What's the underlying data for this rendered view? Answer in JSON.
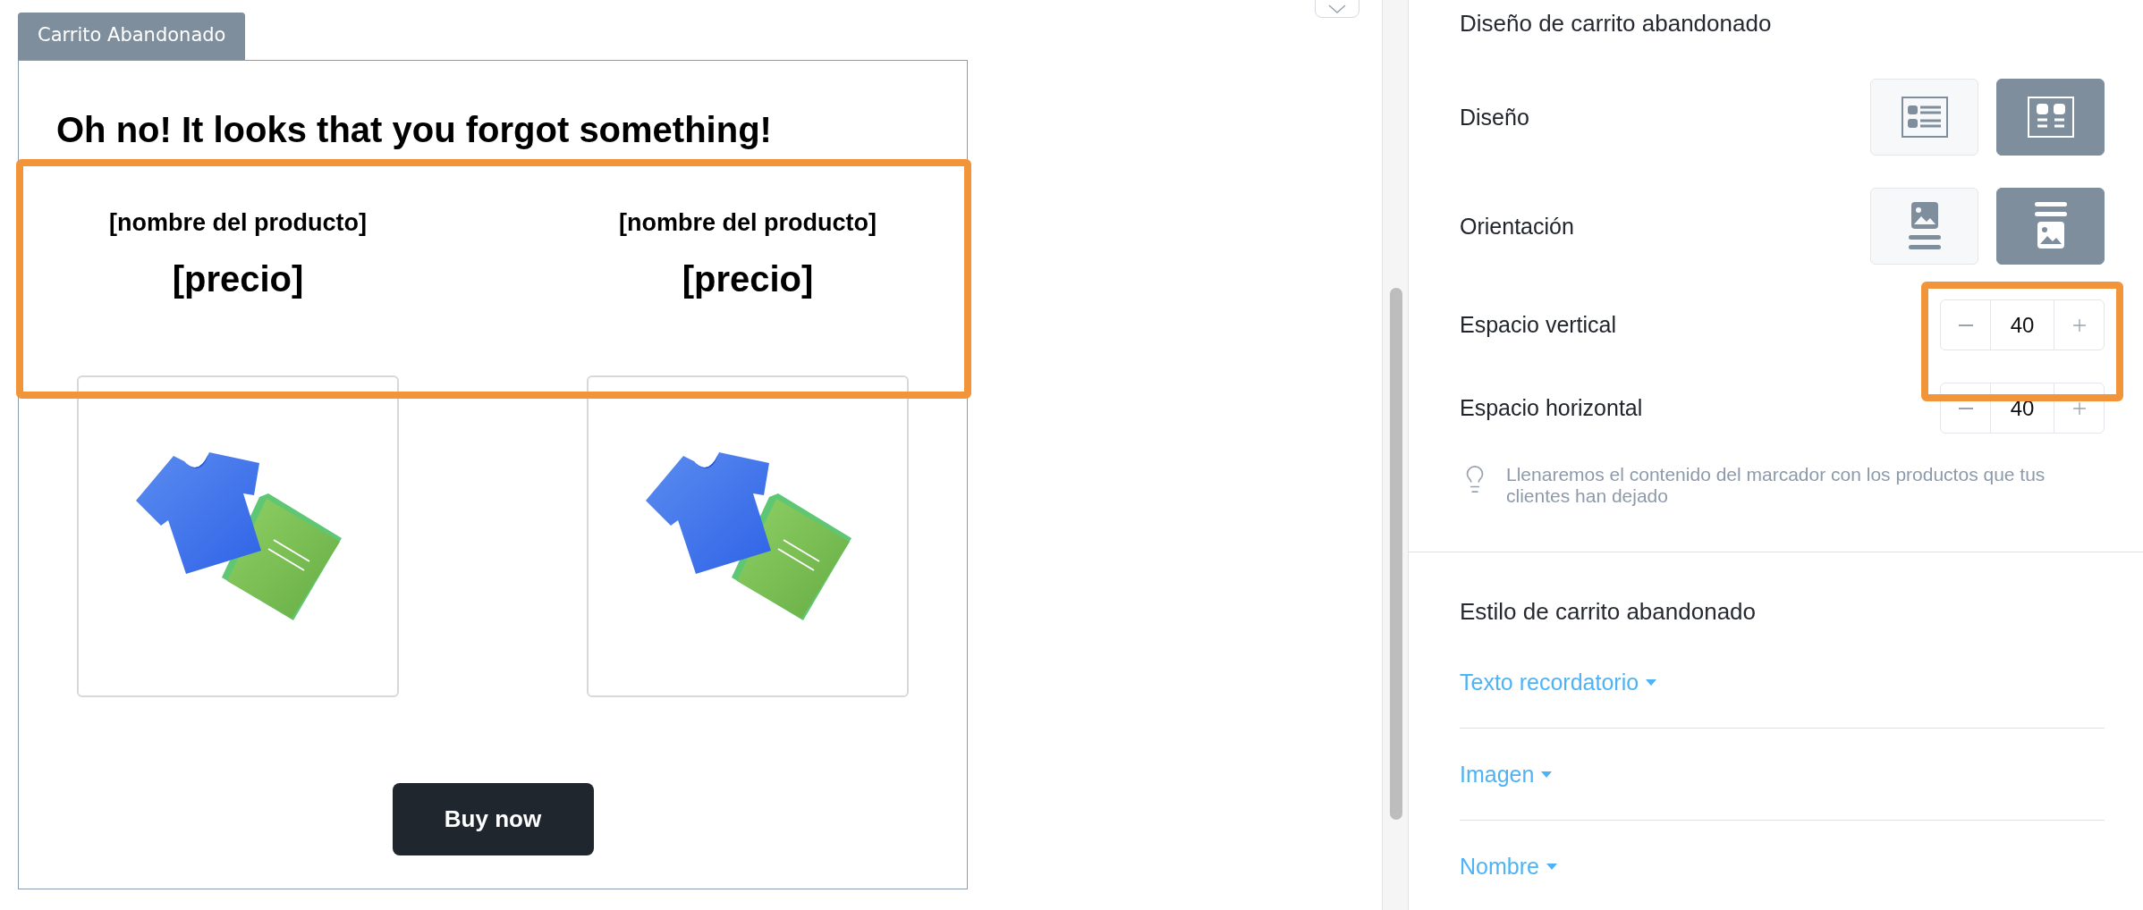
{
  "tab": {
    "label": "Carrito Abandonado"
  },
  "preview": {
    "heading": "Oh no! It looks that you forgot something!",
    "products": [
      {
        "name": "[nombre del producto]",
        "price": "[precio]"
      },
      {
        "name": "[nombre del producto]",
        "price": "[precio]"
      }
    ],
    "button": "Buy now"
  },
  "layout_section": {
    "title": "Diseño de carrito abandonado",
    "rows": [
      {
        "label": "Diseño",
        "kind": "choice",
        "choices": [
          {
            "kind": "list",
            "selected": false
          },
          {
            "kind": "grid",
            "selected": true
          }
        ]
      },
      {
        "label": "Orientación",
        "kind": "choice",
        "choices": [
          {
            "kind": "image-top",
            "selected": false
          },
          {
            "kind": "image-bottom",
            "selected": true
          }
        ]
      },
      {
        "label": "Espacio vertical",
        "kind": "stepper",
        "value": "40"
      },
      {
        "label": "Espacio horizontal",
        "kind": "stepper",
        "value": "40"
      }
    ],
    "hint": "Llenaremos el contenido del marcador con los productos que tus clientes han dejado"
  },
  "style_section": {
    "title": "Estilo de carrito abandonado",
    "dropdowns": [
      "Texto recordatorio",
      "Imagen",
      "Nombre"
    ]
  }
}
